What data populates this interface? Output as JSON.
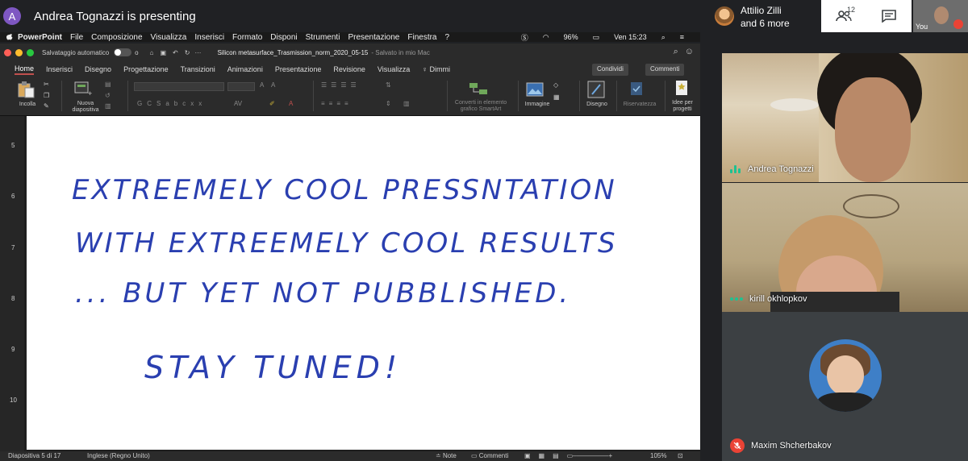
{
  "meet": {
    "avatar_letter": "A",
    "presenting_text": "Andrea Tognazzi is presenting",
    "others_name": "Attilio Zilli",
    "others_more": "and 6 more",
    "people_count": "12",
    "self_label": "You"
  },
  "mac": {
    "app": "PowerPoint",
    "menus": [
      "File",
      "Composizione",
      "Visualizza",
      "Inserisci",
      "Formato",
      "Disponi",
      "Strumenti",
      "Presentazione",
      "Finestra",
      "?"
    ],
    "battery": "96%",
    "clock": "Ven 15:23"
  },
  "ppt": {
    "autosave_label": "Salvataggio automatico",
    "autosave_state": "o",
    "doc_title": "Silicon metasurface_Trasmission_norm_2020_05-15",
    "doc_status": "- Salvato in mio Mac",
    "tabs": [
      "Home",
      "Inserisci",
      "Disegno",
      "Progettazione",
      "Transizioni",
      "Animazioni",
      "Presentazione",
      "Revisione",
      "Visualizza",
      "Dimmi"
    ],
    "share": "Condividi",
    "comments": "Commenti",
    "ribbon": {
      "paste": "Incolla",
      "new_slide": "Nuova\ndiapositiva",
      "smartart": "Converti in elemento\ngrafico SmartArt",
      "image": "Immagine",
      "design": "Disegno",
      "confidentiality": "Riservatezza",
      "ideas": "Idee per\nprogetti"
    },
    "ruler": [
      "5",
      "6",
      "7",
      "8",
      "9",
      "10"
    ],
    "slide_lines": [
      "EXTREEMELY COOL PRESSNTATION",
      "WITH EXTREEMELY COOL RESULTS",
      "... BUT YET NOT PUBBLISHED.",
      "STAY TUNED!"
    ],
    "status": {
      "slide": "Diapositiva 5 di 17",
      "language": "Inglese (Regno Unito)",
      "notes": "Note",
      "comments": "Commenti",
      "zoom": "105%"
    }
  },
  "participants": [
    {
      "name": "Andrea Tognazzi",
      "state": "speaking"
    },
    {
      "name": "kirill okhlopkov",
      "state": "active"
    },
    {
      "name": "Maxim Shcherbakov",
      "state": "muted"
    }
  ],
  "colors": {
    "ink": "#2a3fb0",
    "speaking": "#1ec292",
    "muted": "#ea4335",
    "ppt_accent": "#c0504d"
  }
}
